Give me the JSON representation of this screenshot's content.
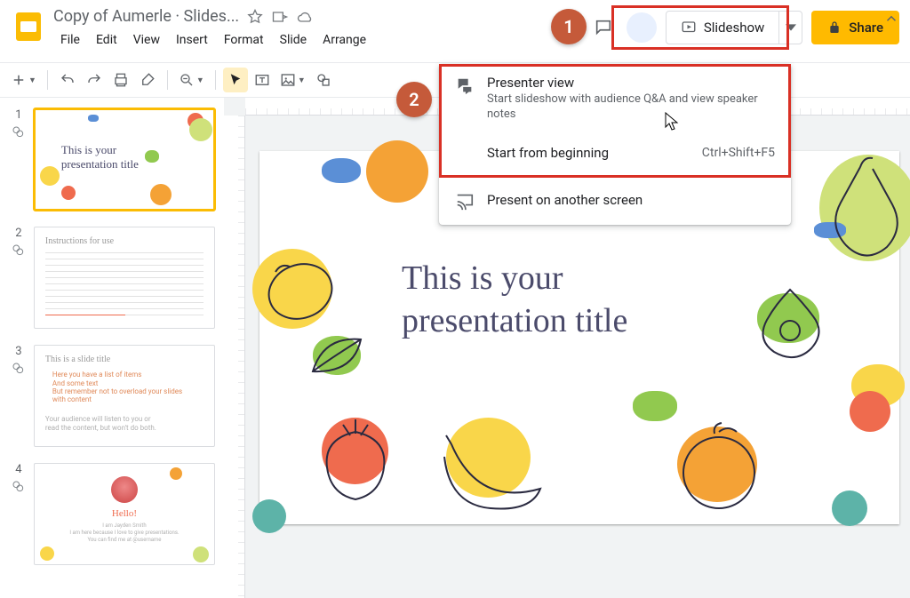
{
  "header": {
    "doc_title": "Copy of Aumerle · Slides...",
    "menus": [
      "File",
      "Edit",
      "View",
      "Insert",
      "Format",
      "Slide",
      "Arrange"
    ],
    "slideshow_label": "Slideshow",
    "share_label": "Share"
  },
  "dropdown": {
    "presenter_title": "Presenter view",
    "presenter_sub": "Start slideshow with audience Q&A and view speaker notes",
    "start_beginning": "Start from beginning",
    "start_shortcut": "Ctrl+Shift+F5",
    "another_screen": "Present on another screen"
  },
  "callouts": {
    "one": "1",
    "two": "2"
  },
  "filmstrip": [
    {
      "num": "1",
      "title_l1": "This is your",
      "title_l2": "presentation title"
    },
    {
      "num": "2",
      "heading": "Instructions for use"
    },
    {
      "num": "3",
      "heading": "This is a slide title",
      "bullets": [
        "Here you have a list of items",
        "And some text",
        "But remember not to overload your slides with content"
      ],
      "footer_l1": "Your audience will listen to you or",
      "footer_l2": "read the content, but won't do both."
    },
    {
      "num": "4",
      "heading": "Hello!",
      "sub1": "I am Jayden Smith",
      "sub2": "I am here because I love to give presentations.",
      "sub3": "You can find me at @username"
    }
  ],
  "slide": {
    "title_l1": "This is your",
    "title_l2": "presentation title"
  },
  "icons": {
    "star": "star-icon",
    "move": "move-icon",
    "cloud": "cloud-icon",
    "comment": "comment-icon",
    "play": "play-icon",
    "caret": "caret-down-icon",
    "lock": "lock-icon",
    "cast": "cast-icon",
    "qa": "qa-icon",
    "new_slide": "plus-icon",
    "undo": "undo-icon",
    "redo": "redo-icon",
    "print": "print-icon",
    "paint": "paint-format-icon",
    "zoom": "zoom-icon",
    "cursor": "cursor-icon",
    "textbox": "textbox-icon",
    "image": "image-icon",
    "shape": "shape-icon",
    "collapse": "chevron-up-icon",
    "notes": "notes-icon"
  },
  "colors": {
    "yellow": "#f9d64a",
    "orange": "#f4a236",
    "red": "#ef6b4e",
    "green": "#91c94f",
    "lime": "#cfe17a",
    "teal": "#5db3a8",
    "blue": "#5b8fd6",
    "purple": "#8a6fb3"
  }
}
